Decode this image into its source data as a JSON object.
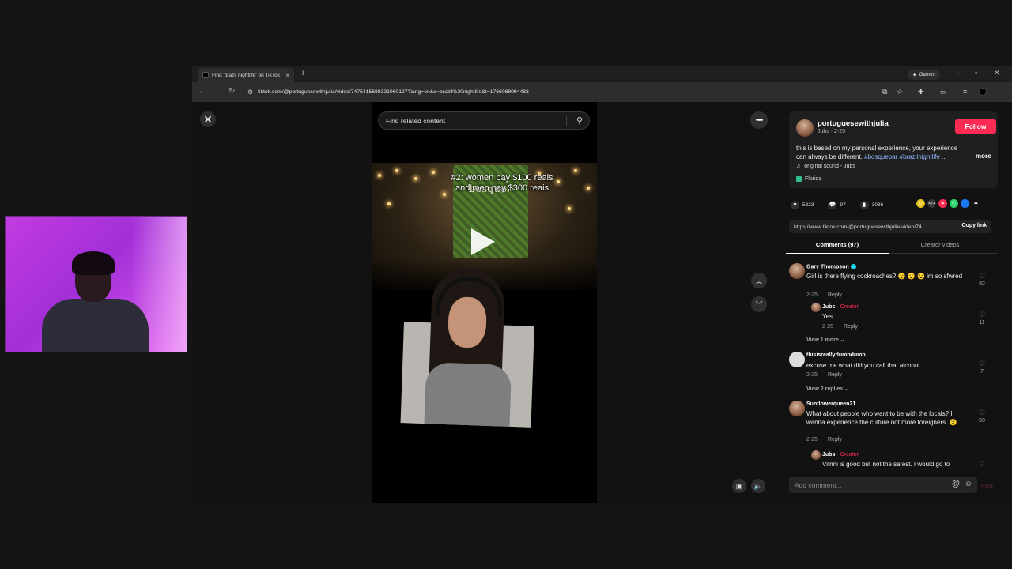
{
  "browser": {
    "tab_title": "Find 'brazil nightlife' on TikTok",
    "new_tab": "+",
    "gemini_label": "Gemini",
    "url": "tiktok.com/@portuguesewithjulia/video/7475415688321060127?lang=en&q=brazil%20nightlife&t=1766088094483"
  },
  "page": {
    "search_placeholder": "Find related content",
    "video_caption": "#2: women pay $100 reais and men pay $300 reais",
    "venue_logo": "bosque."
  },
  "panel": {
    "creator_name": "portuguesewithjulia",
    "creator_sub": "Jubs · 2-25",
    "follow_label": "Follow",
    "description_text": "this is based on my personal experience, your experience can always be different. ",
    "hashtag1": "#bosquebar",
    "hashtag2": "#brazilnightlife",
    "ellipsis": " ...",
    "more_label": "more",
    "sound": "original sound - Jubs",
    "location": "Florida",
    "likes": "5323",
    "comments_count": "97",
    "saves": "3086",
    "link": "https://www.tiktok.com/@portuguesewithjulia/video/74...",
    "copy_link": "Copy link",
    "tab_comments": "Comments (97)",
    "tab_creator_videos": "Creator videos",
    "comment_placeholder": "Add comment...",
    "post_label": "Post"
  },
  "comments": [
    {
      "name": "Gary Thompson",
      "text": "Girl is there flying cockroaches? 😮 😮 😮 im so sfwred",
      "date": "2-25",
      "reply": "Reply",
      "likes": "82"
    },
    {
      "name": "Jubs",
      "creator_tag": " · Creator",
      "text": "Yes",
      "date": "2-25",
      "reply": "Reply",
      "likes": "11"
    },
    {
      "view_more": "View 1 more ⌄"
    },
    {
      "name": "thisisreallydumbdumb",
      "text": "excuse me what did you call that alcohol",
      "date": "2-25",
      "reply": "Reply",
      "likes": "7"
    },
    {
      "view_more": "View 2 replies ⌄"
    },
    {
      "name": "Sunflowerqueen21",
      "text": "What about people who want to be with the locals? I wanna experience the culture not more foreigners. 😮",
      "date": "2-25",
      "reply": "Reply",
      "likes": "50"
    },
    {
      "name": "Jubs",
      "creator_tag": " · Creator",
      "text": "Vitrini is good but not the safest. I would go to"
    }
  ]
}
